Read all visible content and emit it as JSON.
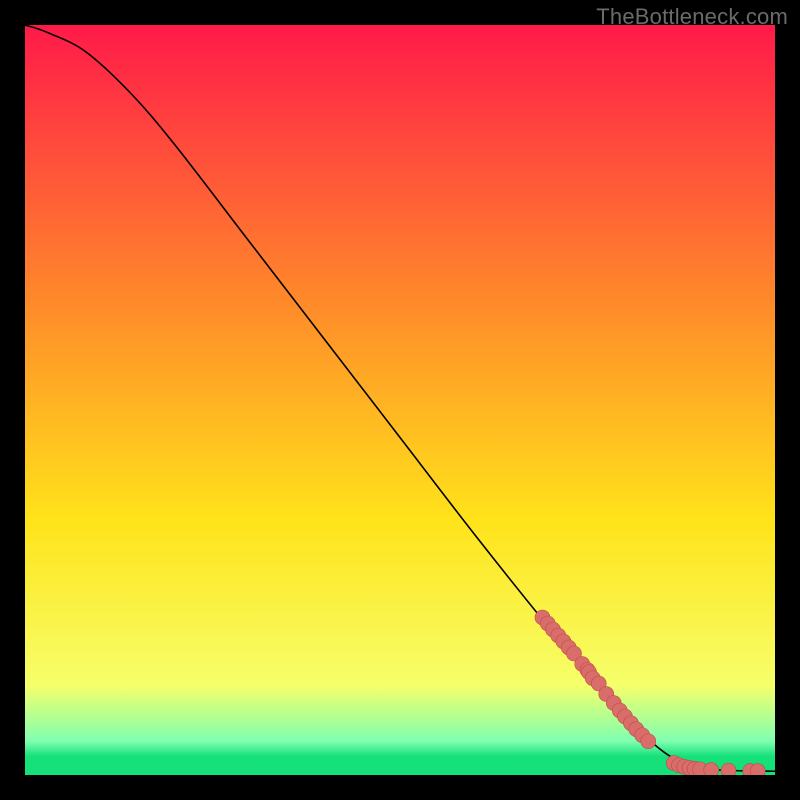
{
  "watermark": "TheBottleneck.com",
  "colors": {
    "page_bg": "#000000",
    "curve": "#000000",
    "marker_fill": "#d96d6a",
    "marker_stroke": "#bd4a47",
    "grad_top": "#ff1a49",
    "grad_mid_high": "#ff8a2a",
    "grad_mid": "#ffe31a",
    "grad_low": "#f6ff6a",
    "grad_band": "#7fffb0",
    "grad_bottom": "#15e07a"
  },
  "chart_data": {
    "type": "line",
    "title": "",
    "xlabel": "",
    "ylabel": "",
    "xlim": [
      0,
      100
    ],
    "ylim": [
      0,
      100
    ],
    "curve": [
      {
        "x": 0,
        "y": 100
      },
      {
        "x": 3,
        "y": 99
      },
      {
        "x": 8,
        "y": 96.5
      },
      {
        "x": 14,
        "y": 91
      },
      {
        "x": 20,
        "y": 84
      },
      {
        "x": 30,
        "y": 71
      },
      {
        "x": 40,
        "y": 58
      },
      {
        "x": 50,
        "y": 45
      },
      {
        "x": 60,
        "y": 32
      },
      {
        "x": 70,
        "y": 19.5
      },
      {
        "x": 78,
        "y": 10
      },
      {
        "x": 84,
        "y": 4
      },
      {
        "x": 88,
        "y": 1.5
      },
      {
        "x": 92,
        "y": 0.7
      },
      {
        "x": 100,
        "y": 0.5
      }
    ],
    "markers": [
      {
        "x": 69.0,
        "y": 21.0
      },
      {
        "x": 69.7,
        "y": 20.2
      },
      {
        "x": 70.4,
        "y": 19.4
      },
      {
        "x": 71.1,
        "y": 18.6
      },
      {
        "x": 71.8,
        "y": 17.8
      },
      {
        "x": 72.5,
        "y": 17.0
      },
      {
        "x": 73.2,
        "y": 16.2
      },
      {
        "x": 74.3,
        "y": 14.8
      },
      {
        "x": 75.0,
        "y": 14.0
      },
      {
        "x": 75.2,
        "y": 13.7
      },
      {
        "x": 75.7,
        "y": 12.9
      },
      {
        "x": 76.5,
        "y": 12.2
      },
      {
        "x": 77.5,
        "y": 10.8
      },
      {
        "x": 78.5,
        "y": 9.6
      },
      {
        "x": 79.3,
        "y": 8.6
      },
      {
        "x": 80.0,
        "y": 7.8
      },
      {
        "x": 80.8,
        "y": 6.9
      },
      {
        "x": 81.5,
        "y": 6.1
      },
      {
        "x": 82.3,
        "y": 5.3
      },
      {
        "x": 83.1,
        "y": 4.5
      },
      {
        "x": 86.5,
        "y": 1.6
      },
      {
        "x": 87.2,
        "y": 1.3
      },
      {
        "x": 87.9,
        "y": 1.1
      },
      {
        "x": 88.6,
        "y": 0.95
      },
      {
        "x": 89.3,
        "y": 0.82
      },
      {
        "x": 90.0,
        "y": 0.75
      },
      {
        "x": 91.5,
        "y": 0.66
      },
      {
        "x": 93.8,
        "y": 0.58
      },
      {
        "x": 96.7,
        "y": 0.53
      },
      {
        "x": 97.7,
        "y": 0.51
      }
    ]
  }
}
